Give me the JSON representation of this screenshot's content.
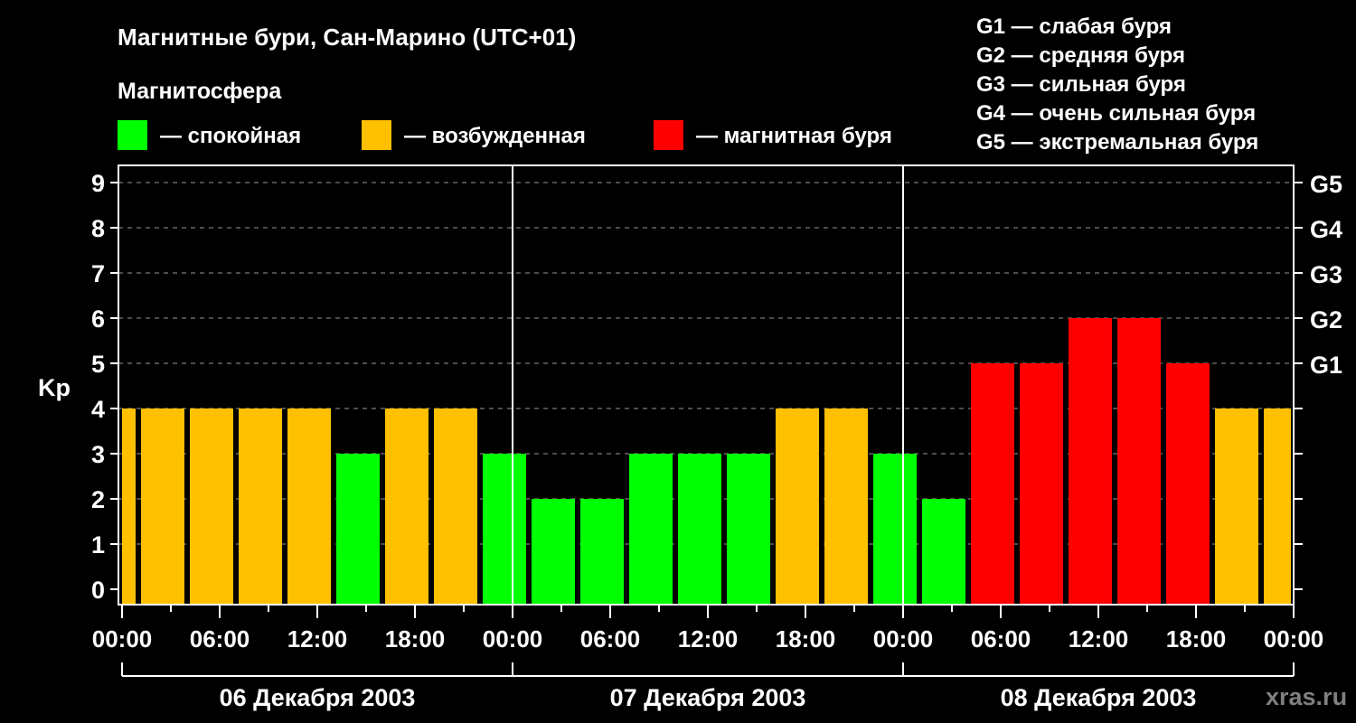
{
  "chart_data": {
    "type": "bar",
    "title": "Магнитные бури, Сан-Марино (UTC+01)",
    "legend_title": "Магнитосфера",
    "legend": [
      {
        "label": "— спокойная",
        "color": "#00ff00"
      },
      {
        "label": "— возбужденная",
        "color": "#ffc000"
      },
      {
        "label": "— магнитная буря",
        "color": "#ff0000"
      }
    ],
    "g_scale": [
      "G1 — слабая буря",
      "G2 — средняя буря",
      "G3 — сильная буря",
      "G4 — очень сильная буря",
      "G5 — экстремальная буря"
    ],
    "ylabel": "Kp",
    "ylim": [
      0,
      9
    ],
    "yticks": [
      0,
      1,
      2,
      3,
      4,
      5,
      6,
      7,
      8,
      9
    ],
    "right_ticks": [
      {
        "value": 5,
        "label": "G1"
      },
      {
        "value": 6,
        "label": "G2"
      },
      {
        "value": 7,
        "label": "G3"
      },
      {
        "value": 8,
        "label": "G4"
      },
      {
        "value": 9,
        "label": "G5"
      }
    ],
    "xlim_hours": [
      0,
      72
    ],
    "xtick_labels": [
      "00:00",
      "06:00",
      "12:00",
      "18:00",
      "00:00",
      "06:00",
      "12:00",
      "18:00",
      "00:00",
      "06:00",
      "12:00",
      "18:00",
      "00:00"
    ],
    "days": [
      "06 Декабря 2003",
      "07 Декабря 2003",
      "08 Декабря 2003"
    ],
    "bars": [
      {
        "start": 0,
        "end": 1,
        "kp": 4
      },
      {
        "start": 1,
        "end": 4,
        "kp": 4
      },
      {
        "start": 4,
        "end": 7,
        "kp": 4
      },
      {
        "start": 7,
        "end": 10,
        "kp": 4
      },
      {
        "start": 10,
        "end": 13,
        "kp": 4
      },
      {
        "start": 13,
        "end": 16,
        "kp": 3
      },
      {
        "start": 16,
        "end": 19,
        "kp": 4
      },
      {
        "start": 19,
        "end": 22,
        "kp": 4
      },
      {
        "start": 22,
        "end": 25,
        "kp": 3
      },
      {
        "start": 25,
        "end": 28,
        "kp": 2
      },
      {
        "start": 28,
        "end": 31,
        "kp": 2
      },
      {
        "start": 31,
        "end": 34,
        "kp": 3
      },
      {
        "start": 34,
        "end": 37,
        "kp": 3
      },
      {
        "start": 37,
        "end": 40,
        "kp": 3
      },
      {
        "start": 40,
        "end": 43,
        "kp": 4
      },
      {
        "start": 43,
        "end": 46,
        "kp": 4
      },
      {
        "start": 46,
        "end": 49,
        "kp": 3
      },
      {
        "start": 49,
        "end": 52,
        "kp": 2
      },
      {
        "start": 52,
        "end": 55,
        "kp": 5
      },
      {
        "start": 55,
        "end": 58,
        "kp": 5
      },
      {
        "start": 58,
        "end": 61,
        "kp": 6
      },
      {
        "start": 61,
        "end": 64,
        "kp": 6
      },
      {
        "start": 64,
        "end": 67,
        "kp": 5
      },
      {
        "start": 67,
        "end": 70,
        "kp": 4
      },
      {
        "start": 70,
        "end": 72,
        "kp": 4
      }
    ],
    "grid": true
  },
  "watermark": "xras.ru"
}
